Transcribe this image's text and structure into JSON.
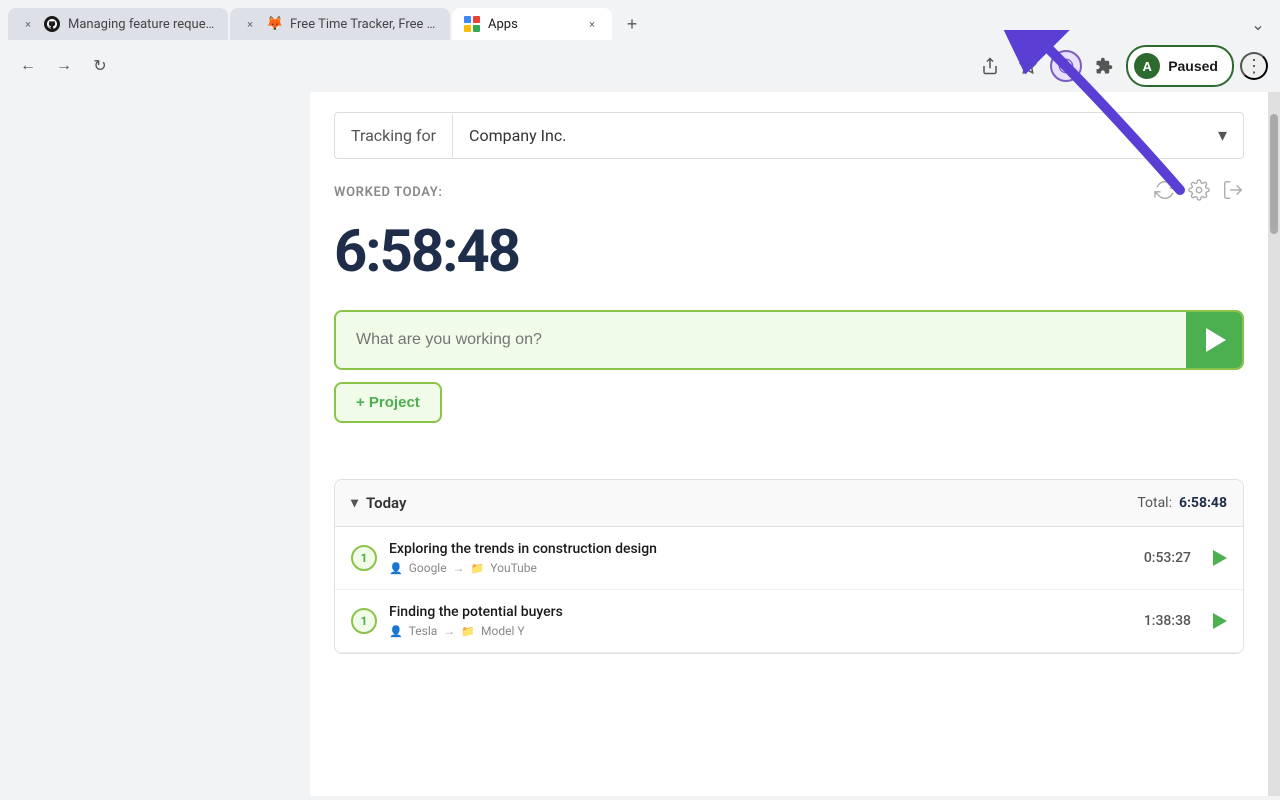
{
  "browser": {
    "tabs": [
      {
        "id": "tab-github",
        "favicon_type": "github",
        "title": "Managing feature requests",
        "active": false,
        "close_label": "×"
      },
      {
        "id": "tab-tracker",
        "favicon_type": "tracker",
        "title": "Free Time Tracker, Free Em...",
        "active": false,
        "close_label": "×"
      },
      {
        "id": "tab-apps",
        "favicon_type": "apps",
        "title": "Apps",
        "active": true,
        "close_label": "×"
      }
    ],
    "new_tab_label": "+",
    "tab_overflow_label": "⌄",
    "nav": {
      "back_label": "←",
      "forward_label": "→",
      "reload_label": "↻",
      "share_label": "⬆",
      "bookmark_label": "☆",
      "extensions_label": "🧩",
      "more_label": "⋮",
      "paused_label": "Paused",
      "avatar_label": "A"
    }
  },
  "app": {
    "tracking_label": "Tracking for",
    "company_name": "Company Inc.",
    "worked_today_label": "WORKED TODAY:",
    "timer": "6:58:48",
    "task_placeholder": "What are you working on?",
    "add_project_label": "+ Project",
    "today_section": {
      "label": "Today",
      "total_label": "Total:",
      "total_time": "6:58:48",
      "entries": [
        {
          "number": "1",
          "title": "Exploring the trends in construction design",
          "source": "Google",
          "destination": "YouTube",
          "time": "0:53:27"
        },
        {
          "number": "1",
          "title": "Finding the potential buyers",
          "source": "Tesla",
          "destination": "Model Y",
          "time": "1:38:38"
        }
      ]
    }
  }
}
